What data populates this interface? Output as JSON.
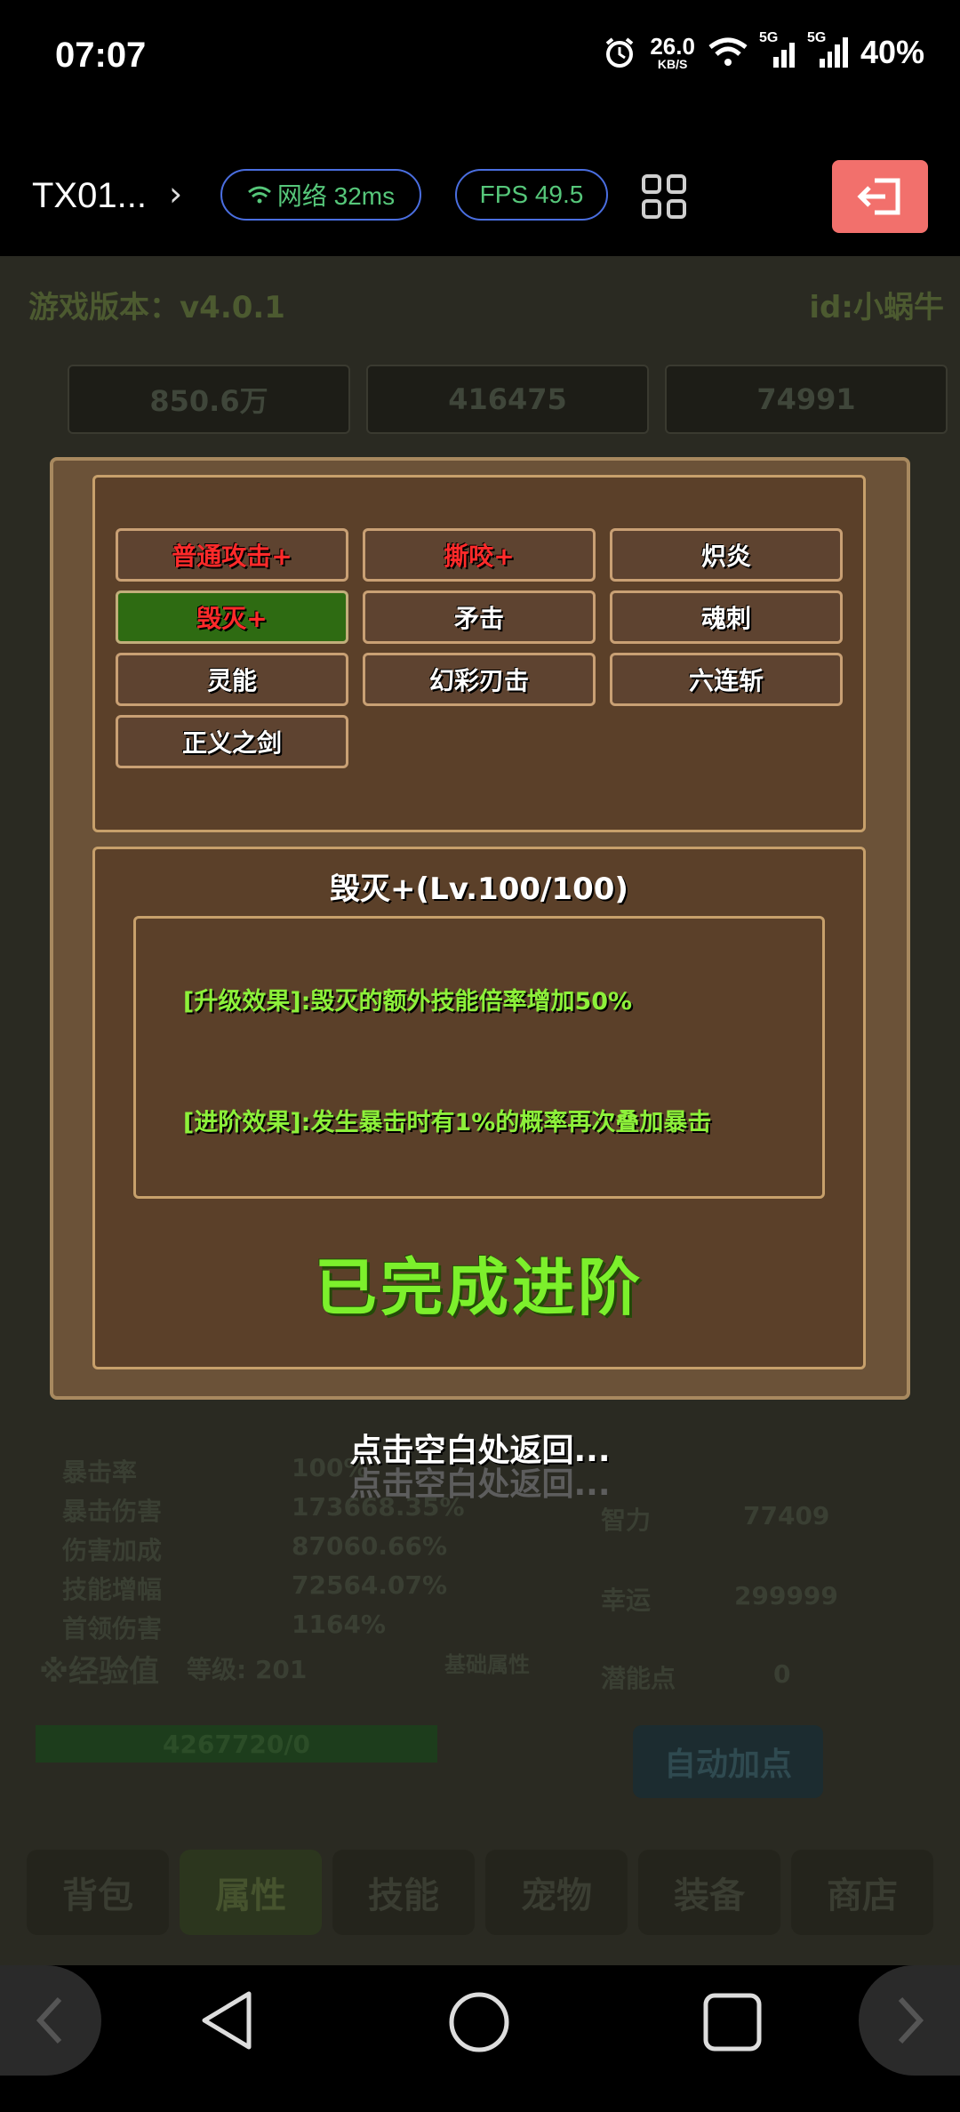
{
  "status_bar": {
    "time": "07:07",
    "net_speed_value": "26.0",
    "net_speed_unit": "KB/S",
    "signal1_label": "5G",
    "signal2_label": "5G",
    "battery": "40%"
  },
  "toolbar": {
    "title": "TX01...",
    "network_label": "网络 32ms",
    "fps_label": "FPS 49.5"
  },
  "game_background": {
    "version": "游戏版本：v4.0.1",
    "user_id": "id:小蜗牛",
    "resources": [
      "850.6万",
      "416475",
      "74991"
    ],
    "stats_left": [
      {
        "label": "暴击率",
        "value": "100%"
      },
      {
        "label": "暴击伤害",
        "value": "173668.35%"
      },
      {
        "label": "伤害加成",
        "value": "87060.66%"
      },
      {
        "label": "技能增幅",
        "value": "72564.07%"
      },
      {
        "label": "首领伤害",
        "value": "1164%"
      }
    ],
    "stats_right": [
      {
        "label": "智力",
        "value": "77409"
      },
      {
        "label": "幸运",
        "value": "299999"
      },
      {
        "label": "潜能点",
        "value": "0"
      }
    ],
    "exp_label": "※经验值",
    "level_label": "等级: 201",
    "exp_value": "4267720/0",
    "center_label": "基础属性",
    "auto_button": "自动加点",
    "tabs": [
      "背包",
      "属性",
      "技能",
      "宠物",
      "装备",
      "商店"
    ]
  },
  "skills": [
    {
      "label": "普通攻击+"
    },
    {
      "label": "撕咬+"
    },
    {
      "label": "炽炎"
    },
    {
      "label": "毁灭+"
    },
    {
      "label": "矛击"
    },
    {
      "label": "魂刺"
    },
    {
      "label": "灵能"
    },
    {
      "label": "幻彩刃击"
    },
    {
      "label": "六连斩"
    },
    {
      "label": "正义之剑"
    }
  ],
  "detail": {
    "title": "毁灭+(Lv.100/100)",
    "effect_upgrade": "[升级效果]:毁灭的额外技能倍率增加50%",
    "effect_advance": "[进阶效果]:发生暴击时有1%的概率再次叠加暴击",
    "status": "已完成进阶"
  },
  "hint": "点击空白处返回...",
  "colors": {
    "accent_green": "#7cf02c",
    "skill_red": "#ff2a2a",
    "exit_button": "#f2706c",
    "popup_brown": "#6b5238"
  },
  "icons": [
    "wifi-icon",
    "grid-icon",
    "exit-icon",
    "back-icon",
    "home-icon",
    "recents-icon",
    "alarm-icon"
  ]
}
